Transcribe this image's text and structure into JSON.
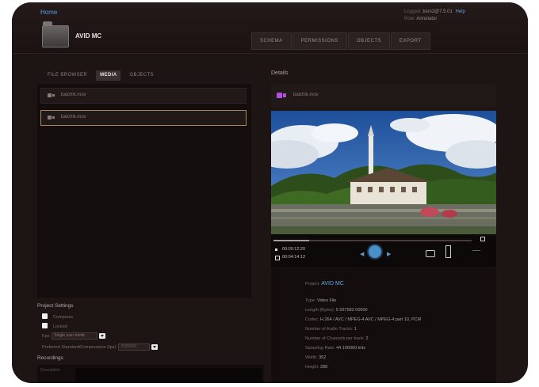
{
  "header": {
    "home_link": "Home",
    "user_prefix": "Logged:",
    "user_name": "bsm2@7.5.01",
    "help_link": "Help",
    "role_prefix": "Role:",
    "role": "Annotator",
    "app_title": "AVID MC"
  },
  "main_tabs": [
    {
      "label": "SCHEMA"
    },
    {
      "label": "PERMISSIONS"
    },
    {
      "label": "OBJECTS"
    },
    {
      "label": "EXPORT"
    }
  ],
  "sub_tabs": [
    {
      "label": "FILE BROWSER",
      "active": false
    },
    {
      "label": "MEDIA",
      "active": true
    },
    {
      "label": "OBJECTS",
      "active": false
    }
  ],
  "media_list": [
    {
      "label": "balchik.mov",
      "selected": false
    },
    {
      "label": "balchik.mov",
      "selected": true
    }
  ],
  "details": {
    "title": "Details",
    "file_label": "balchik.mov",
    "timecode_start": "00:00:12:20",
    "timecode_end": "00:04:14:12",
    "project_label": "Project:",
    "project_value": "AVID MC",
    "info_lines": [
      {
        "label": "Type:",
        "value": "Video File"
      },
      {
        "label": "Length (Bytes):",
        "value": "5 567582 00000"
      },
      {
        "label": "Codec:",
        "value": "H.264 / AVC / MPEG-4 AVC / MPEG-4 part 10, PCM"
      },
      {
        "label": "Number of Audio Tracks:",
        "value": "1"
      },
      {
        "label": "Number of Channels per track:",
        "value": "2"
      },
      {
        "label": "Sampling Rate:",
        "value": "44 100000 kHz"
      },
      {
        "label": "Width:",
        "value": "352"
      },
      {
        "label": "Height:",
        "value": "288"
      }
    ],
    "progress": 0.18
  },
  "project_settings": {
    "title": "Project Settings",
    "checkbox1": "Compress",
    "checkbox2": "Locked",
    "fps_label": "Fps:",
    "fps_value": "Single user mode",
    "preferred_label": "Preferred Standard/Compression (fps):",
    "preferred_value": "25/50/60"
  },
  "recordings": {
    "title": "Recordings",
    "col_label": "Description"
  },
  "colors": {
    "accent_link": "#5b9fd6",
    "selected_border": "#a88656",
    "video_icon": "#b24fd8",
    "background": "#1d1414"
  },
  "icons": [
    "folder-icon",
    "video-file-icon",
    "play-icon",
    "camera-icon",
    "fullscreen-icon"
  ]
}
